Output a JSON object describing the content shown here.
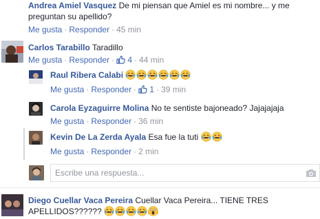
{
  "comments": [
    {
      "author": "Andrea Amiel Vasquez",
      "text_line1": "De mi piensan que Amiel es mi nombre... y me",
      "text_line2": "preguntan su apellido?",
      "like_label": "Me gusta",
      "reply_label": "Responder",
      "time": "45 min"
    },
    {
      "author": "Carlos Tarabillo",
      "text": "Taradillo",
      "like_label": "Me gusta",
      "reply_label": "Responder",
      "like_count": "4",
      "time": "44 min"
    }
  ],
  "replies": [
    {
      "author": "Raul Ribera Calabi",
      "text": "",
      "emojis": [
        "laugh-cry-emoji",
        "laugh-cry-emoji",
        "laugh-cry-emoji",
        "laugh-cry-emoji",
        "laugh-cry-emoji",
        "laugh-cry-emoji"
      ],
      "like_label": "Me gusta",
      "reply_label": "Responder",
      "like_count": "1",
      "time": "39 min"
    },
    {
      "author": "Carola Eyzaguirre Molina",
      "text": "No te sentiste bajoneado? Jajajajaja",
      "like_label": "Me gusta",
      "reply_label": "Responder",
      "time": "36 min"
    },
    {
      "author": "Kevin De La Zerda Ayala",
      "text": "Esa fue la tuti",
      "emojis": [
        "laugh-cry-emoji",
        "laugh-cry-emoji"
      ],
      "like_label": "Me gusta",
      "reply_label": "Responder",
      "time": "2 min"
    }
  ],
  "reply_box": {
    "placeholder": "Escribe una respuesta..."
  },
  "last_comment": {
    "author": "Diego Cuellar Vaca Pereira",
    "text_line1": "Cuellar Vaca Pereira... TIENE TRES",
    "text_line2": "APELLIDOS??????",
    "emojis": [
      "laugh-cry-emoji",
      "laugh-cry-emoji",
      "laugh-cry-emoji",
      "laugh-cry-emoji",
      "screaming-emoji"
    ]
  },
  "colors": {
    "link": "#365899",
    "action": "#4267b2",
    "meta": "#90949c",
    "emoji_face": "#f7c948"
  }
}
